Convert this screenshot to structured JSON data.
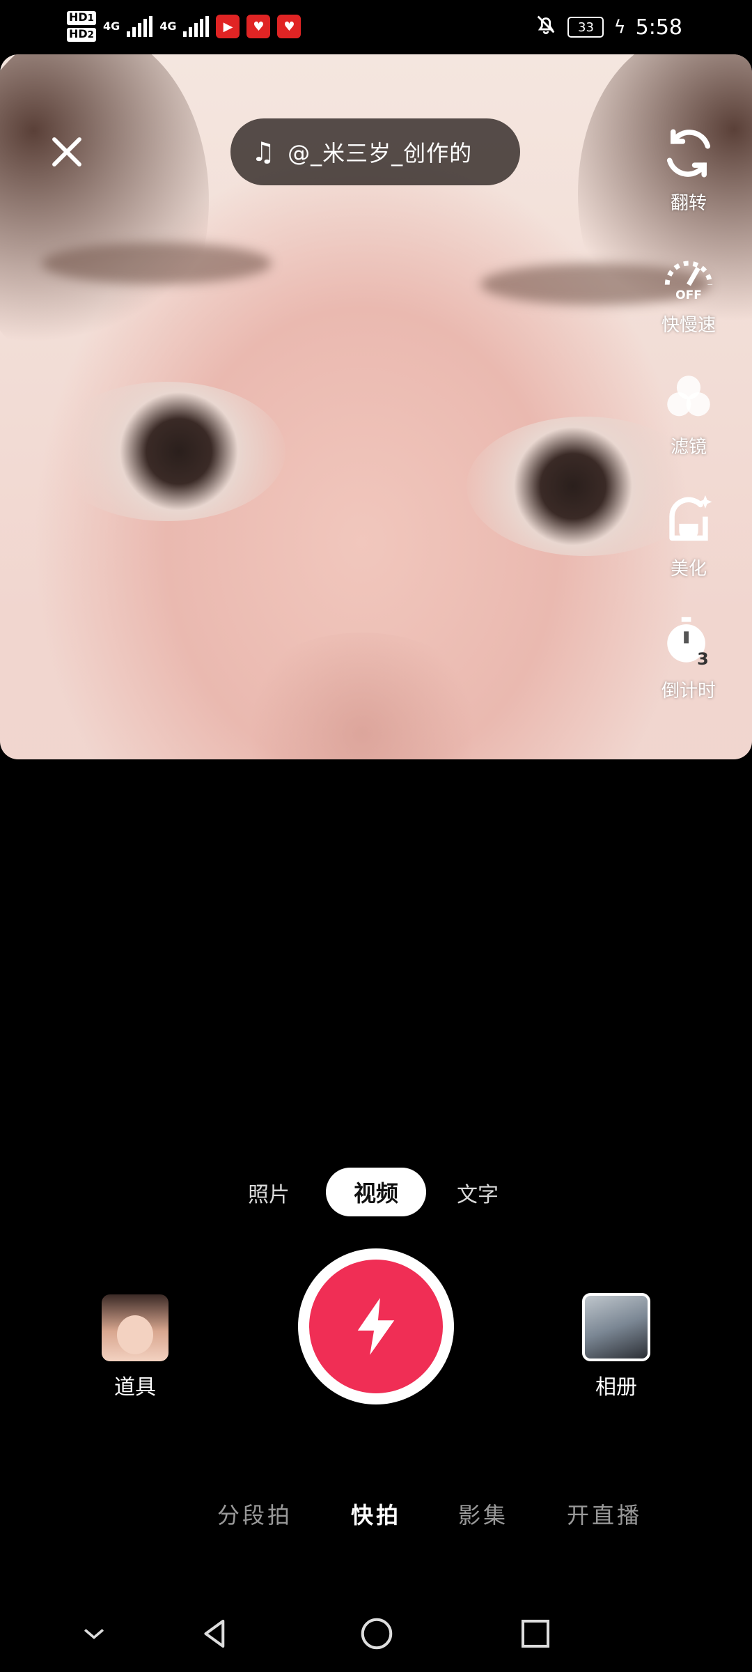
{
  "status_bar": {
    "hd1": "HD",
    "hd1_sub": "1",
    "hd2": "HD",
    "hd2_sub": "2",
    "net1": "4G",
    "net2": "4G",
    "battery": "33",
    "time": "5:58",
    "icons": [
      "signal-icon",
      "video-app-icon",
      "heart-app-icon",
      "heart-app-icon",
      "mute-bell-icon",
      "battery-icon",
      "charging-icon"
    ]
  },
  "top_bar": {
    "close_icon": "close-icon",
    "music_icon": "music-note-icon",
    "music_text": "@_米三岁_创作的"
  },
  "side_tools": [
    {
      "icon": "flip-camera-icon",
      "label": "翻转"
    },
    {
      "icon": "speed-gauge-icon",
      "label": "快慢速",
      "badge": "OFF"
    },
    {
      "icon": "filter-icon",
      "label": "滤镜"
    },
    {
      "icon": "beautify-icon",
      "label": "美化"
    },
    {
      "icon": "timer-icon",
      "label": "倒计时",
      "badge": "3"
    }
  ],
  "modes": {
    "photo": "照片",
    "video": "视频",
    "text": "文字",
    "selected": "视频"
  },
  "capture_row": {
    "props_label": "道具",
    "album_label": "相册",
    "shutter_icon": "lightning-icon"
  },
  "bottom_tabs": [
    {
      "label": "分段拍",
      "active": false
    },
    {
      "label": "快拍",
      "active": true
    },
    {
      "label": "影集",
      "active": false
    },
    {
      "label": "开直播",
      "active": false
    }
  ],
  "nav_bar": [
    "collapse-icon",
    "back-icon",
    "home-icon",
    "recents-icon"
  ]
}
